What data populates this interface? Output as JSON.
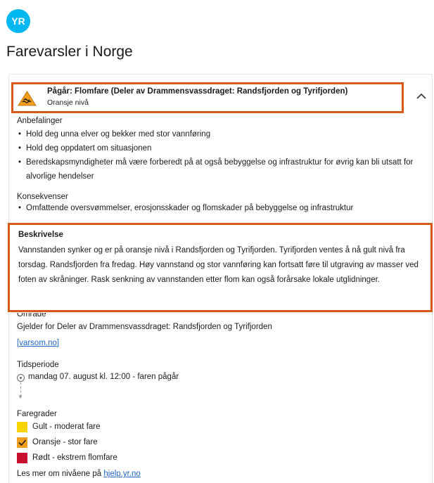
{
  "brand": {
    "logo_text": "YR",
    "logo_color": "#00b8f1"
  },
  "page": {
    "title": "Farevarsler i Norge"
  },
  "warning": {
    "title": "Pågår: Flomfare (Deler av Drammensvassdraget: Randsfjorden og Tyrifjorden)",
    "level": "Oransje nivå",
    "icon": "flood-warning-triangle-icon",
    "highlight_color": "#d65a16"
  },
  "recommendations": {
    "heading": "Anbefalinger",
    "items": [
      "Hold deg unna elver og bekker med stor vannføring",
      "Hold deg oppdatert om situasjonen",
      "Beredskapsmyndigheter må være forberedt på at også bebyggelse og infrastruktur for øvrig kan bli utsatt for alvorlige hendelser"
    ]
  },
  "consequences": {
    "heading": "Konsekvenser",
    "items": [
      "Omfattende oversvømmelser, erosjonsskader og flomskader på bebyggelse og infrastruktur"
    ]
  },
  "description": {
    "heading": "Beskrivelse",
    "text": "Vannstanden synker og er på oransje nivå i Randsfjorden og Tyrifjorden. Tyrifjorden ventes å nå gult nivå fra torsdag. Randsfjorden fra fredag. Høy vannstand og stor vannføring kan fortsatt føre til utgraving av masser ved foten av skråninger. Rask senkning av vannstanden etter flom kan også forårsake lokale utglidninger."
  },
  "area": {
    "heading": "Område",
    "text": "Gjelder for Deler av Drammensvassdraget: Randsfjorden og Tyrifjorden",
    "link": "[varsom.no]"
  },
  "period": {
    "heading": "Tidsperiode",
    "start": "mandag 07. august kl. 12:00 - faren pågår"
  },
  "levels": {
    "heading": "Faregrader",
    "items": [
      {
        "label": "Gult - moderat fare",
        "color": "#f7d300",
        "checked": false
      },
      {
        "label": "Oransje - stor fare",
        "color": "#f29d1c",
        "checked": true
      },
      {
        "label": "Rødt - ekstrem flomfare",
        "color": "#c8102e",
        "checked": false
      }
    ],
    "more_prefix": "Les mer om nivåene på ",
    "more_link": "hjelp.yr.no"
  }
}
